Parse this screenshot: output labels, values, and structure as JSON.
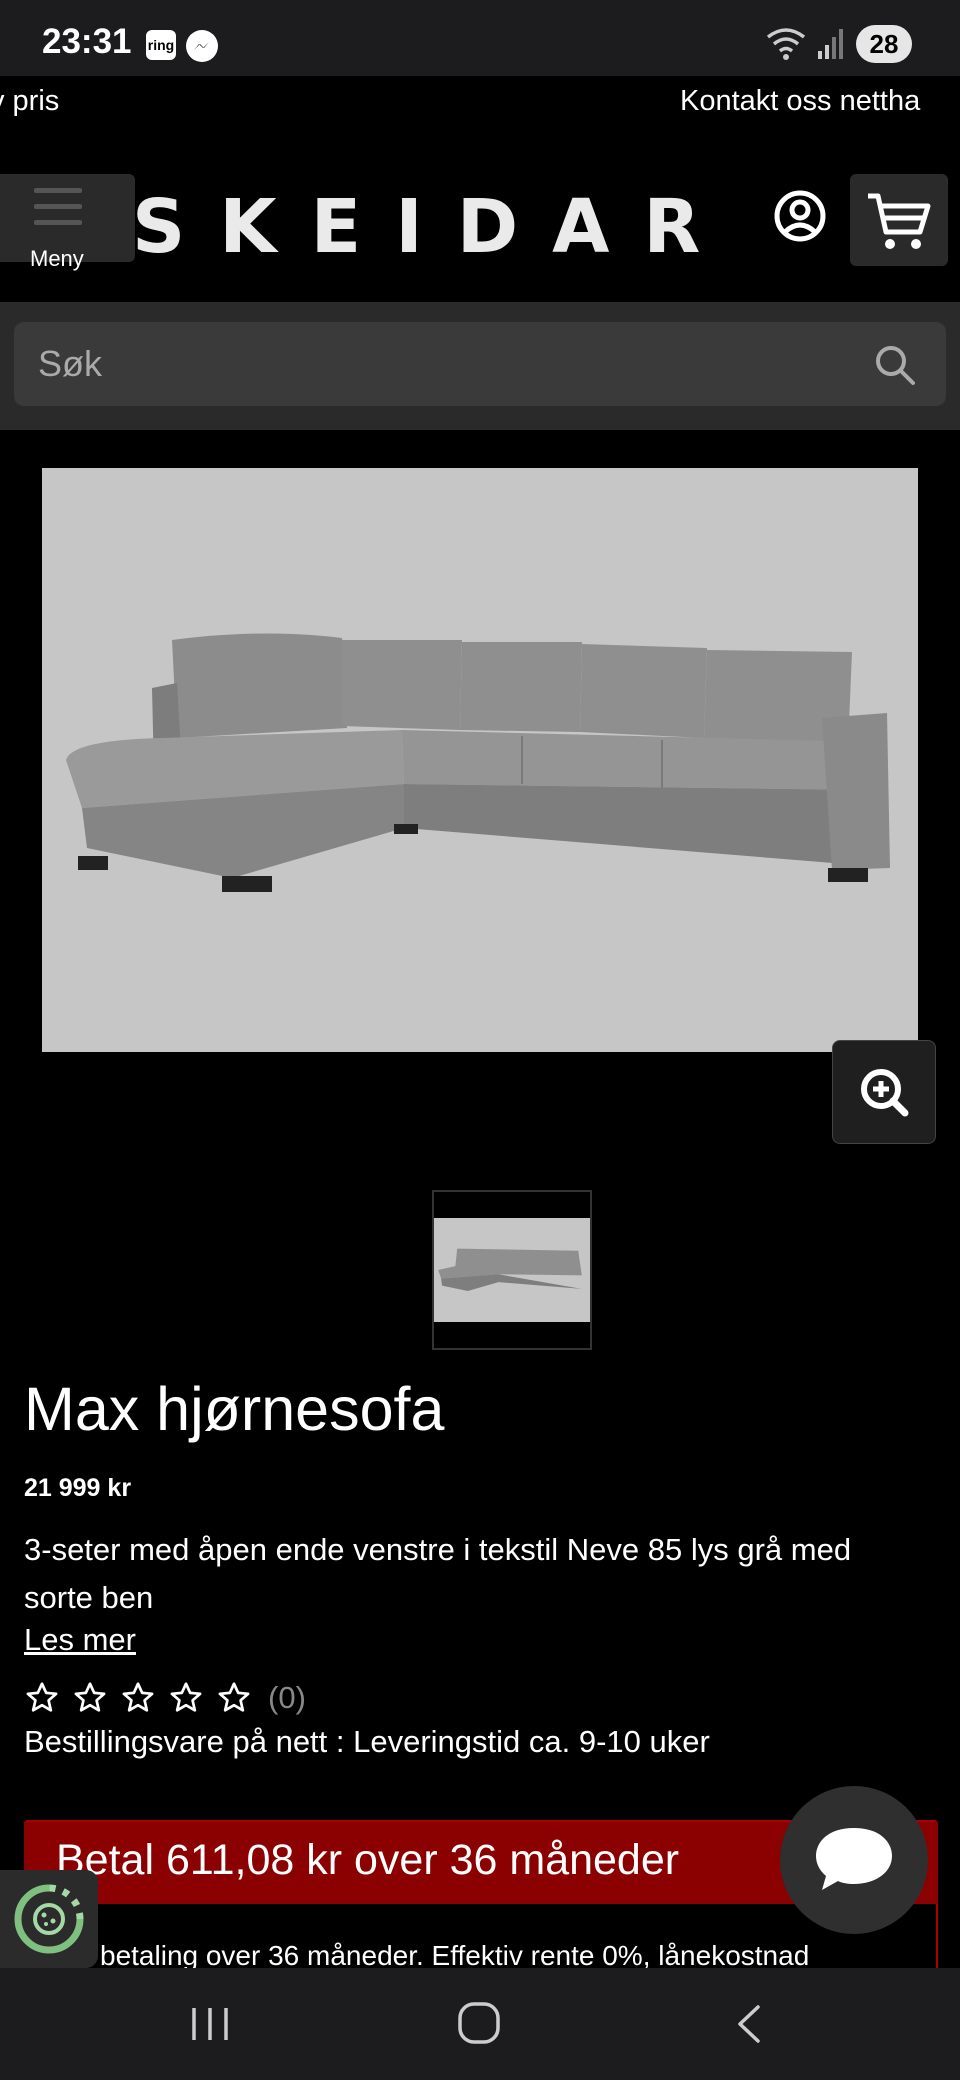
{
  "status_bar": {
    "time": "23:31",
    "ring_label": "ring",
    "battery": "28"
  },
  "promo": {
    "left_text": "v pris",
    "right_text": "Kontakt oss nettha"
  },
  "header": {
    "menu_label": "Meny",
    "logo": "SKEIDAR"
  },
  "search": {
    "placeholder": "Søk"
  },
  "product": {
    "title": "Max hjørnesofa",
    "price": "21 999 kr",
    "description": "3-seter med åpen ende venstre i tekstil Neve 85 lys grå med sorte ben",
    "read_more": "Les mer",
    "rating_count": "(0)",
    "rating_value": 0,
    "rating_max": 5,
    "delivery": "Bestillingsvare på nett : Leveringstid ca. 9-10 uker"
  },
  "payment": {
    "headline": "Betal 611,08 kr over 36 måneder",
    "subtext": "betaling over 36 måneder. Effektiv rente 0%, lånekostnad"
  },
  "colors": {
    "background": "#000000",
    "payment_red": "#8b0000",
    "image_bg": "#c6c6c6",
    "surface": "#2a2a2a"
  },
  "icons": {
    "account": "account-circle-icon",
    "cart": "cart-icon",
    "search": "search-icon",
    "zoom": "zoom-in-icon",
    "chat": "chat-bubble-icon",
    "cookie": "cookie-settings-icon"
  }
}
